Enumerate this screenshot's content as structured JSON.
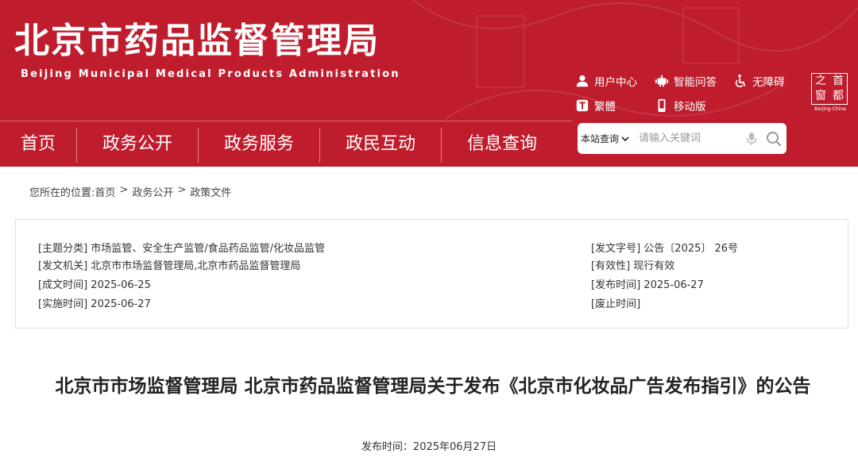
{
  "header": {
    "title": "北京市药品监督管理局",
    "subtitle": "Beijing Municipal Medical Products Administration",
    "tools": [
      {
        "label": "用户中心",
        "icon": "user-icon"
      },
      {
        "label": "智能问答",
        "icon": "robot-icon"
      },
      {
        "label": "无障碍",
        "icon": "wheelchair-icon"
      },
      {
        "label": "繁體",
        "icon": "traditional-chinese-icon"
      },
      {
        "label": "移动版",
        "icon": "mobile-icon"
      }
    ],
    "seal": {
      "chars": [
        "之",
        "首",
        "窗",
        "都"
      ],
      "en": "Beijing-China"
    }
  },
  "nav": {
    "items": [
      "首页",
      "政务公开",
      "政务服务",
      "政民互动",
      "信息查询"
    ]
  },
  "search": {
    "scope": "本站查询",
    "placeholder": "请输入关键词"
  },
  "breadcrumb": {
    "prefix": "您所在的位置:",
    "items": [
      "首页",
      "政务公开",
      "政策文件"
    ],
    "separator": ">"
  },
  "info": {
    "left": [
      {
        "label": "[主题分类]",
        "value": "市场监管、安全生产监管/食品药品监管/化妆品监管"
      },
      {
        "label": "[发文机关]",
        "value": "北京市市场监督管理局,北京市药品监督管理局"
      },
      {
        "label": "[成文时间]",
        "value": "2025-06-25"
      },
      {
        "label": "[实施时间]",
        "value": "2025-06-27"
      }
    ],
    "right": [
      {
        "label": "[发文字号]",
        "value": "公告〔2025〕 26号"
      },
      {
        "label": "[有效性]",
        "value": "现行有效"
      },
      {
        "label": "[发布时间]",
        "value": "2025-06-27"
      },
      {
        "label": "[废止时间]",
        "value": ""
      }
    ]
  },
  "article": {
    "title": "北京市市场监督管理局 北京市药品监督管理局关于发布《北京市化妆品广告发布指引》的公告",
    "pubdate_label": "发布时间：",
    "pubdate": "2025年06月27日"
  },
  "colors": {
    "brand": "#bf1d2d"
  }
}
